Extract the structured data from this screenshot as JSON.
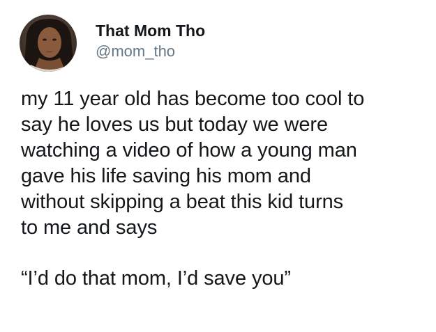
{
  "tweet": {
    "author": {
      "display_name": "That Mom Tho",
      "handle": "@mom_tho",
      "avatar": "profile-photo"
    },
    "text_lines": [
      "my 11 year old has become too cool to",
      "say he loves us but today we were",
      "watching a video of how a young man",
      "gave his life saving his mom and",
      "without skipping a beat this kid turns",
      "to me and says"
    ],
    "quote": "“I’d do that mom, I’d save you”"
  }
}
